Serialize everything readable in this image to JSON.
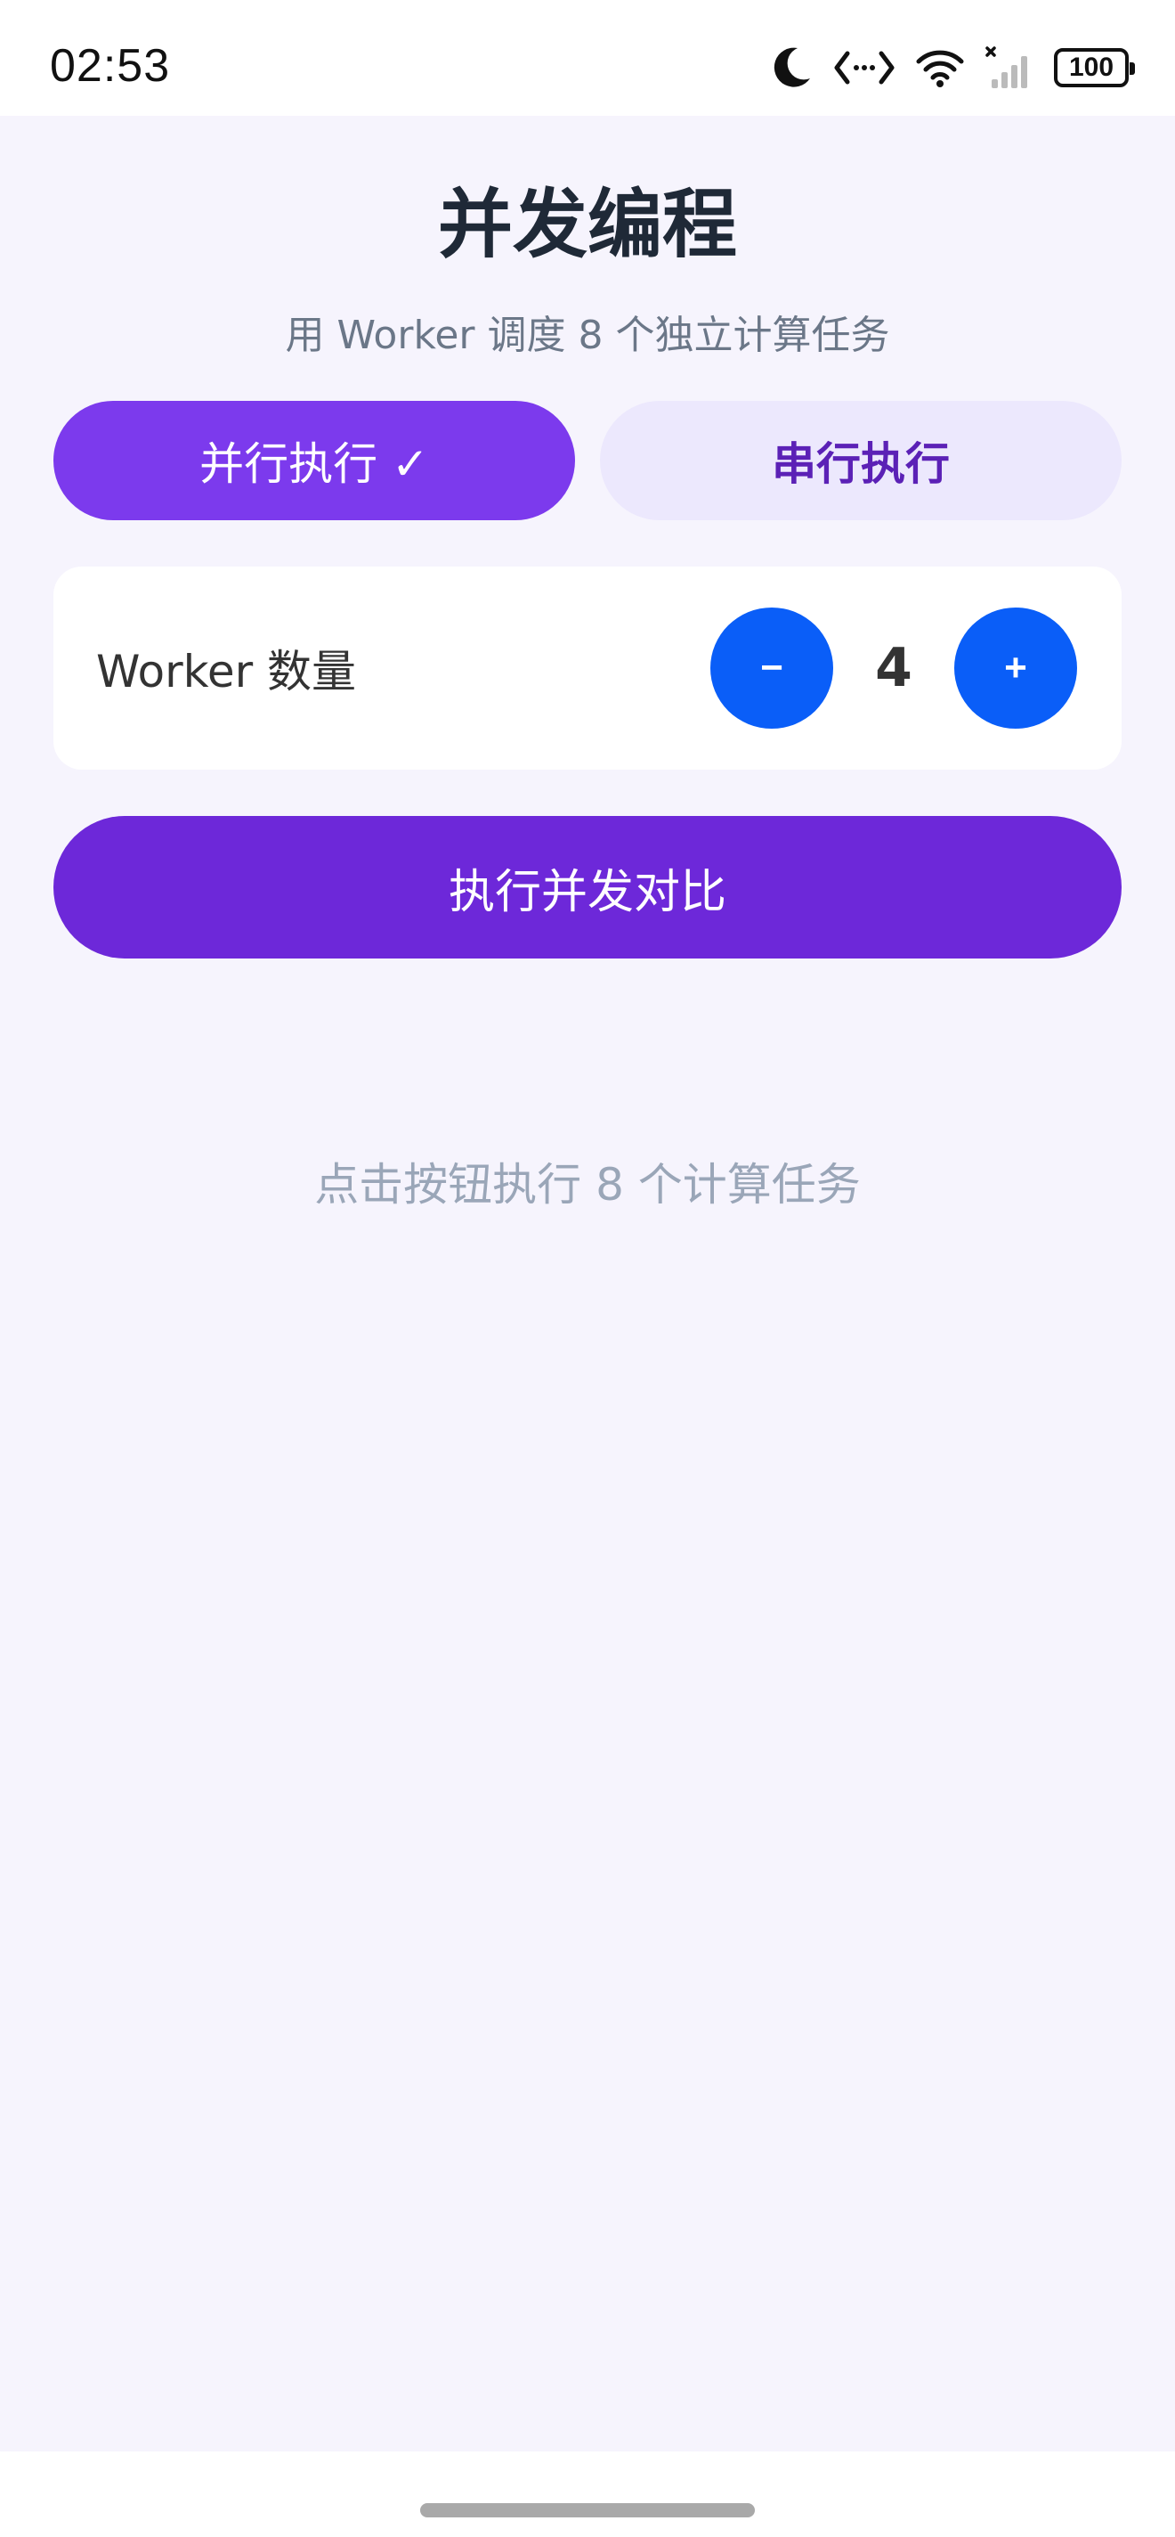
{
  "status_bar": {
    "time": "02:53",
    "icons": [
      "moon-icon",
      "code-arrows-icon",
      "wifi-icon",
      "signal-icon"
    ],
    "battery": "100"
  },
  "header": {
    "title": "并发编程",
    "subtitle": "用 Worker 调度 8 个独立计算任务"
  },
  "modes": {
    "parallel_label": "并行执行 ✓",
    "serial_label": "串行执行",
    "selected": "parallel"
  },
  "worker_control": {
    "label": "Worker 数量",
    "decrement": "−",
    "increment": "+",
    "count": "4"
  },
  "actions": {
    "run_label": "执行并发对比"
  },
  "result": {
    "hint": "点击按钮执行 8 个计算任务"
  },
  "colors": {
    "accent": "#7c3aed",
    "run_button": "#6d28d9",
    "stepper_button": "#0a5ef8",
    "background": "#f6f4fd",
    "serial_bg": "#ece8fd"
  }
}
